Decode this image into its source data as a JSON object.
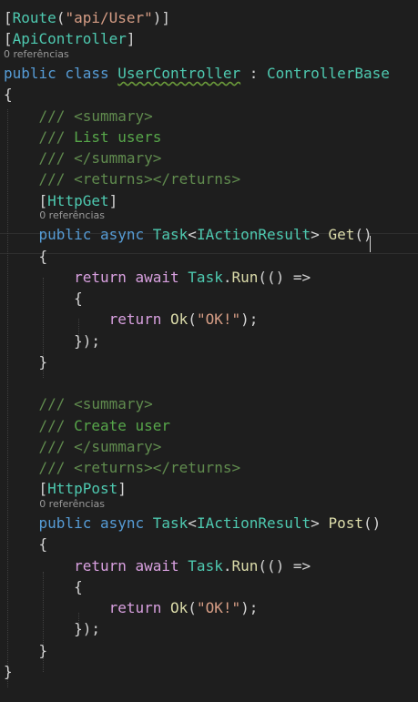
{
  "colors": {
    "background": "#1e1e1e",
    "text": "#d4d4d4",
    "keyword": "#569cd6",
    "control_keyword": "#d8a0df",
    "type": "#4ec9b0",
    "method": "#dcdcaa",
    "string": "#d69d85",
    "comment": "#57a64a",
    "xml_doc_tag": "#608b4e",
    "codelens": "#999999",
    "indent_guide": "#404040"
  },
  "code_lines": [
    {
      "tokens": [
        {
          "t": "[",
          "c": "text"
        },
        {
          "t": "Route",
          "c": "type"
        },
        {
          "t": "(",
          "c": "text"
        },
        {
          "t": "\"api/User\"",
          "c": "string"
        },
        {
          "t": ")]",
          "c": "text"
        }
      ]
    },
    {
      "tokens": [
        {
          "t": "[",
          "c": "text"
        },
        {
          "t": "ApiController",
          "c": "type"
        },
        {
          "t": "]",
          "c": "text"
        }
      ]
    },
    {
      "tokens": [
        {
          "t": "public class ",
          "c": "keyword"
        },
        {
          "t": "UserController",
          "c": "type",
          "squiggle": true
        },
        {
          "t": " : ",
          "c": "text"
        },
        {
          "t": "ControllerBase",
          "c": "type"
        }
      ]
    },
    {
      "tokens": [
        {
          "t": "{",
          "c": "text"
        }
      ]
    },
    {
      "tokens": [
        {
          "t": "    ",
          "c": "text"
        },
        {
          "t": "/// ",
          "c": "xml_doc_tag"
        },
        {
          "t": "<summary>",
          "c": "xml_doc_tag"
        }
      ]
    },
    {
      "tokens": [
        {
          "t": "    ",
          "c": "text"
        },
        {
          "t": "/// ",
          "c": "xml_doc_tag"
        },
        {
          "t": "List users",
          "c": "comment"
        }
      ]
    },
    {
      "tokens": [
        {
          "t": "    ",
          "c": "text"
        },
        {
          "t": "/// ",
          "c": "xml_doc_tag"
        },
        {
          "t": "</summary>",
          "c": "xml_doc_tag"
        }
      ]
    },
    {
      "tokens": [
        {
          "t": "    ",
          "c": "text"
        },
        {
          "t": "/// ",
          "c": "xml_doc_tag"
        },
        {
          "t": "<returns></returns>",
          "c": "xml_doc_tag"
        }
      ]
    },
    {
      "tokens": [
        {
          "t": "    [",
          "c": "text"
        },
        {
          "t": "HttpGet",
          "c": "type"
        },
        {
          "t": "]",
          "c": "text"
        }
      ]
    },
    {
      "tokens": [
        {
          "t": "    ",
          "c": "text"
        },
        {
          "t": "public async ",
          "c": "keyword"
        },
        {
          "t": "Task",
          "c": "type"
        },
        {
          "t": "<",
          "c": "text"
        },
        {
          "t": "IActionResult",
          "c": "type"
        },
        {
          "t": "> ",
          "c": "text"
        },
        {
          "t": "Get",
          "c": "method"
        },
        {
          "t": "()",
          "c": "text"
        }
      ]
    },
    {
      "tokens": [
        {
          "t": "    {",
          "c": "text"
        }
      ]
    },
    {
      "tokens": [
        {
          "t": "        ",
          "c": "text"
        },
        {
          "t": "return await ",
          "c": "control_keyword"
        },
        {
          "t": "Task",
          "c": "type"
        },
        {
          "t": ".",
          "c": "text"
        },
        {
          "t": "Run",
          "c": "method"
        },
        {
          "t": "(() =>",
          "c": "text"
        }
      ]
    },
    {
      "tokens": [
        {
          "t": "        {",
          "c": "text"
        }
      ]
    },
    {
      "tokens": [
        {
          "t": "            ",
          "c": "text"
        },
        {
          "t": "return ",
          "c": "control_keyword"
        },
        {
          "t": "Ok",
          "c": "method"
        },
        {
          "t": "(",
          "c": "text"
        },
        {
          "t": "\"OK!\"",
          "c": "string"
        },
        {
          "t": ");",
          "c": "text"
        }
      ]
    },
    {
      "tokens": [
        {
          "t": "        });",
          "c": "text"
        }
      ]
    },
    {
      "tokens": [
        {
          "t": "    }",
          "c": "text"
        }
      ]
    },
    {
      "tokens": [
        {
          "t": "",
          "c": "text"
        }
      ]
    },
    {
      "tokens": [
        {
          "t": "    ",
          "c": "text"
        },
        {
          "t": "/// ",
          "c": "xml_doc_tag"
        },
        {
          "t": "<summary>",
          "c": "xml_doc_tag"
        }
      ]
    },
    {
      "tokens": [
        {
          "t": "    ",
          "c": "text"
        },
        {
          "t": "/// ",
          "c": "xml_doc_tag"
        },
        {
          "t": "Create user",
          "c": "comment"
        }
      ]
    },
    {
      "tokens": [
        {
          "t": "    ",
          "c": "text"
        },
        {
          "t": "/// ",
          "c": "xml_doc_tag"
        },
        {
          "t": "</summary>",
          "c": "xml_doc_tag"
        }
      ]
    },
    {
      "tokens": [
        {
          "t": "    ",
          "c": "text"
        },
        {
          "t": "/// ",
          "c": "xml_doc_tag"
        },
        {
          "t": "<returns></returns>",
          "c": "xml_doc_tag"
        }
      ]
    },
    {
      "tokens": [
        {
          "t": "    [",
          "c": "text"
        },
        {
          "t": "HttpPost",
          "c": "type"
        },
        {
          "t": "]",
          "c": "text"
        }
      ]
    },
    {
      "tokens": [
        {
          "t": "    ",
          "c": "text"
        },
        {
          "t": "public async ",
          "c": "keyword"
        },
        {
          "t": "Task",
          "c": "type"
        },
        {
          "t": "<",
          "c": "text"
        },
        {
          "t": "IActionResult",
          "c": "type"
        },
        {
          "t": "> ",
          "c": "text"
        },
        {
          "t": "Post",
          "c": "method"
        },
        {
          "t": "()",
          "c": "text"
        }
      ]
    },
    {
      "tokens": [
        {
          "t": "    {",
          "c": "text"
        }
      ]
    },
    {
      "tokens": [
        {
          "t": "        ",
          "c": "text"
        },
        {
          "t": "return await ",
          "c": "control_keyword"
        },
        {
          "t": "Task",
          "c": "type"
        },
        {
          "t": ".",
          "c": "text"
        },
        {
          "t": "Run",
          "c": "method"
        },
        {
          "t": "(() =>",
          "c": "text"
        }
      ]
    },
    {
      "tokens": [
        {
          "t": "        {",
          "c": "text"
        }
      ]
    },
    {
      "tokens": [
        {
          "t": "            ",
          "c": "text"
        },
        {
          "t": "return ",
          "c": "control_keyword"
        },
        {
          "t": "Ok",
          "c": "method"
        },
        {
          "t": "(",
          "c": "text"
        },
        {
          "t": "\"OK!\"",
          "c": "string"
        },
        {
          "t": ");",
          "c": "text"
        }
      ]
    },
    {
      "tokens": [
        {
          "t": "        });",
          "c": "text"
        }
      ]
    },
    {
      "tokens": [
        {
          "t": "    }",
          "c": "text"
        }
      ]
    },
    {
      "tokens": [
        {
          "t": "}",
          "c": "text"
        }
      ]
    }
  ],
  "codelens": [
    {
      "after_line": 1,
      "indent": 0,
      "label": "0 referências"
    },
    {
      "after_line": 8,
      "indent": 4,
      "label": "0 referências"
    },
    {
      "after_line": 21,
      "indent": 4,
      "label": "0 referências"
    }
  ]
}
